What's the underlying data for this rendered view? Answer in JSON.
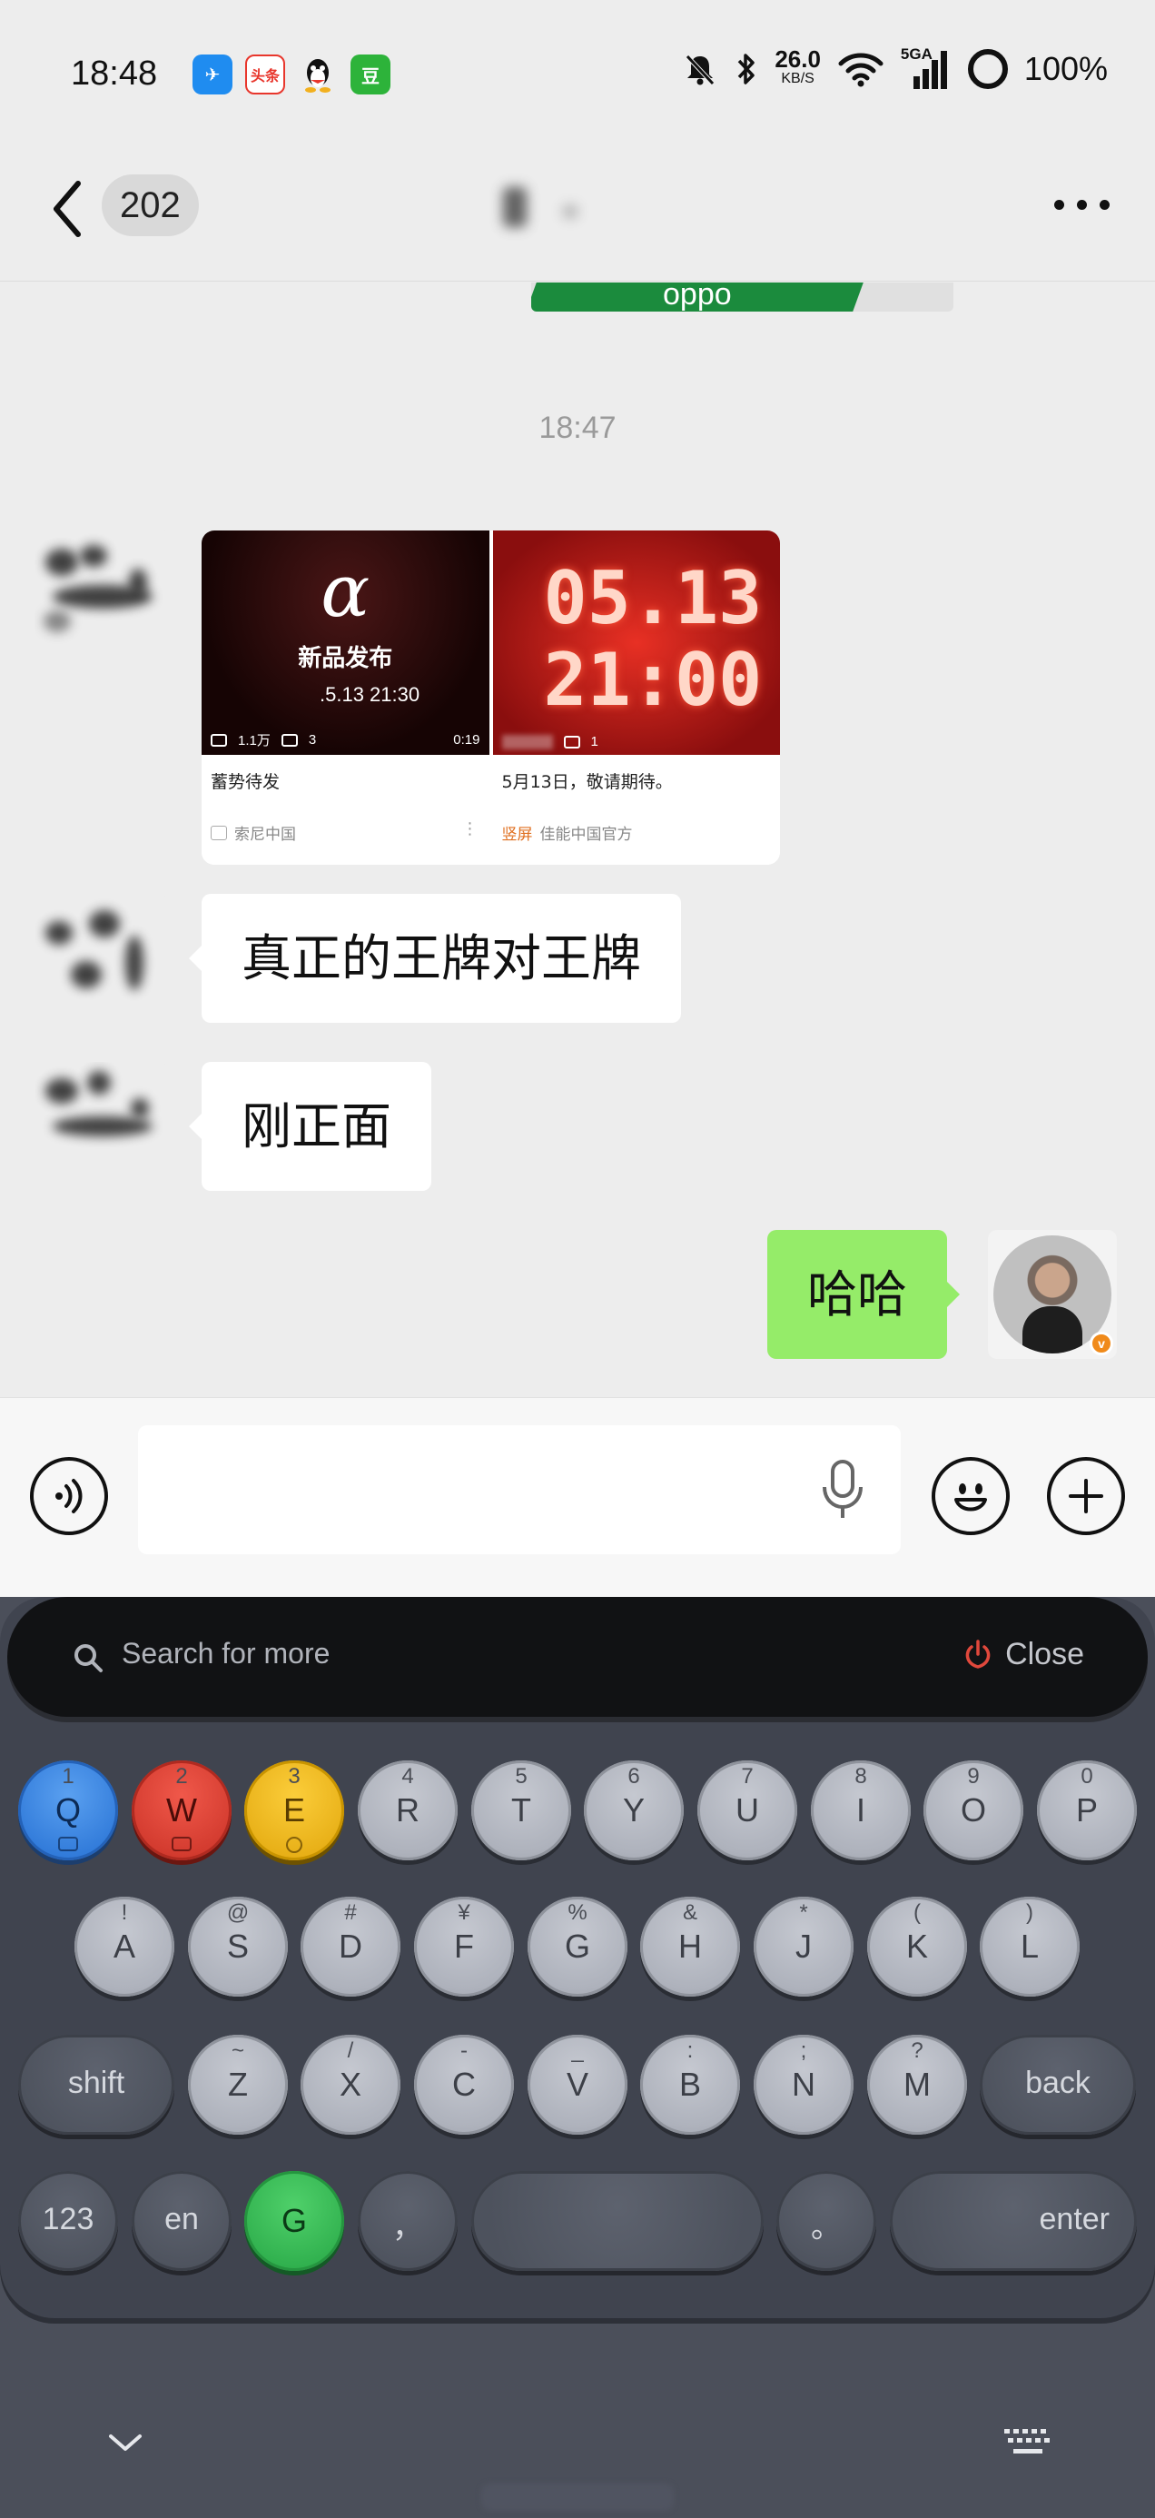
{
  "status_bar": {
    "time": "18:48",
    "app_icons": [
      {
        "name": "feishu-icon",
        "color": "#1f8cf0",
        "glyph": "✈"
      },
      {
        "name": "toutiao-icon",
        "color": "#e8362c",
        "glyph": "头条"
      },
      {
        "name": "qq-icon",
        "color": "#ffffff",
        "glyph": "🐧"
      },
      {
        "name": "douban-icon",
        "color": "#2db33a",
        "glyph": "豆"
      }
    ],
    "net_speed": "26.0",
    "net_speed_unit": "KB/S",
    "network": "5GA",
    "battery": "100%"
  },
  "header": {
    "unread_count": "202"
  },
  "chat": {
    "timestamp": "18:47",
    "link_cards": [
      {
        "hero": "α",
        "hero_title": "新品发布",
        "hero_date": ".5.13  21:30",
        "views": "1.1万",
        "comments": "3",
        "duration": "0:19",
        "description": "蓄势待发",
        "source": "索尼中国",
        "tag": ""
      },
      {
        "hero_line1": "05.13",
        "hero_line2": "21:00",
        "views": "",
        "comments": "1",
        "duration": "",
        "description": "5月13日，敬请期待。",
        "source": "佳能中国官方",
        "tag": "竖屏"
      }
    ],
    "messages": [
      {
        "text": "真正的王牌对王牌",
        "side": "in"
      },
      {
        "text": "刚正面",
        "side": "in"
      },
      {
        "text": "哈哈",
        "side": "out"
      }
    ],
    "previous_banner_text": "oppo"
  },
  "input": {
    "value": "",
    "placeholder": ""
  },
  "keyboard": {
    "search_placeholder": "Search for more",
    "close_label": "Close",
    "row1": [
      {
        "k": "Q",
        "s": "1"
      },
      {
        "k": "W",
        "s": "2"
      },
      {
        "k": "E",
        "s": "3"
      },
      {
        "k": "R",
        "s": "4"
      },
      {
        "k": "T",
        "s": "5"
      },
      {
        "k": "Y",
        "s": "6"
      },
      {
        "k": "U",
        "s": "7"
      },
      {
        "k": "I",
        "s": "8"
      },
      {
        "k": "O",
        "s": "9"
      },
      {
        "k": "P",
        "s": "0"
      }
    ],
    "row2": [
      {
        "k": "A",
        "s": "!"
      },
      {
        "k": "S",
        "s": "@"
      },
      {
        "k": "D",
        "s": "#"
      },
      {
        "k": "F",
        "s": "¥"
      },
      {
        "k": "G",
        "s": "%"
      },
      {
        "k": "H",
        "s": "&"
      },
      {
        "k": "J",
        "s": "*"
      },
      {
        "k": "K",
        "s": "("
      },
      {
        "k": "L",
        "s": ")"
      }
    ],
    "row3": [
      {
        "k": "Z",
        "s": "~"
      },
      {
        "k": "X",
        "s": "/"
      },
      {
        "k": "C",
        "s": "-"
      },
      {
        "k": "V",
        "s": "_"
      },
      {
        "k": "B",
        "s": ":"
      },
      {
        "k": "N",
        "s": ";"
      },
      {
        "k": "M",
        "s": "?"
      }
    ],
    "shift_label": "shift",
    "back_label": "back",
    "num_label": "123",
    "lang_label": "en",
    "g_label": "G",
    "comma_label": "，",
    "period_label": "。",
    "enter_label": "enter",
    "accent_colors": {
      "q": "#2e78d8",
      "w": "#d0382c",
      "e": "#e6ad14",
      "g": "#2eae4c"
    }
  }
}
